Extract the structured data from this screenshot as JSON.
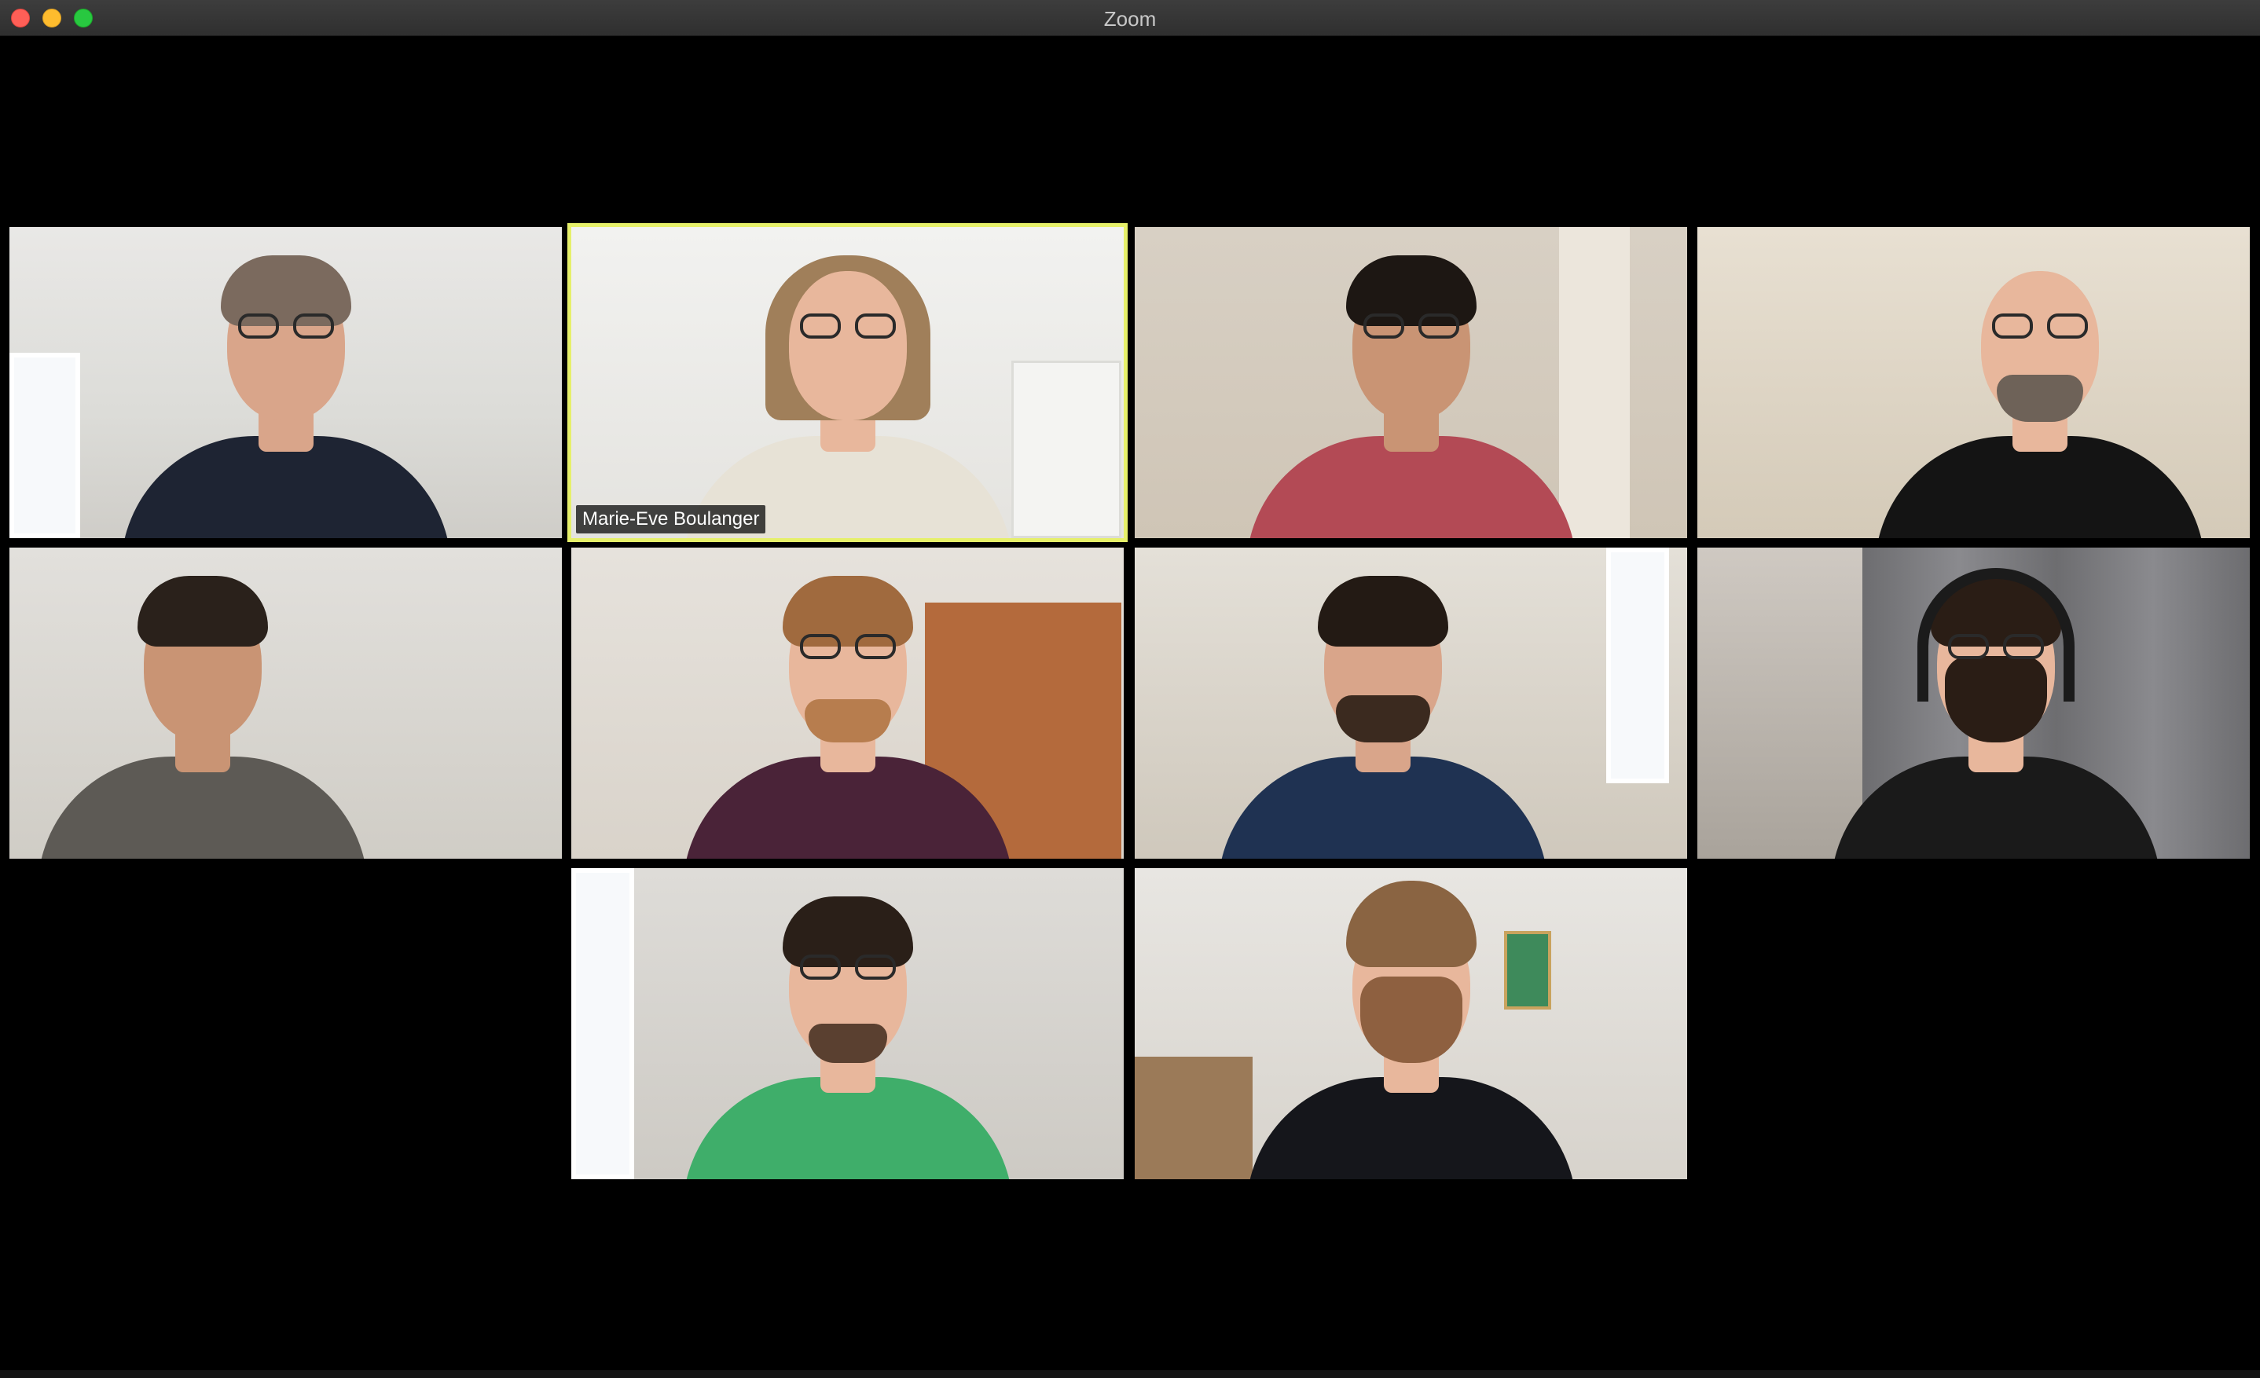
{
  "window": {
    "title": "Zoom"
  },
  "participants": [
    {
      "name": ""
    },
    {
      "name": "Marie-Eve Boulanger",
      "active_speaker": true
    },
    {
      "name": ""
    },
    {
      "name": ""
    },
    {
      "name": ""
    },
    {
      "name": ""
    },
    {
      "name": ""
    },
    {
      "name": ""
    },
    {
      "name": ""
    },
    {
      "name": ""
    }
  ],
  "colors": {
    "active_speaker_border": "#e6f06a"
  }
}
